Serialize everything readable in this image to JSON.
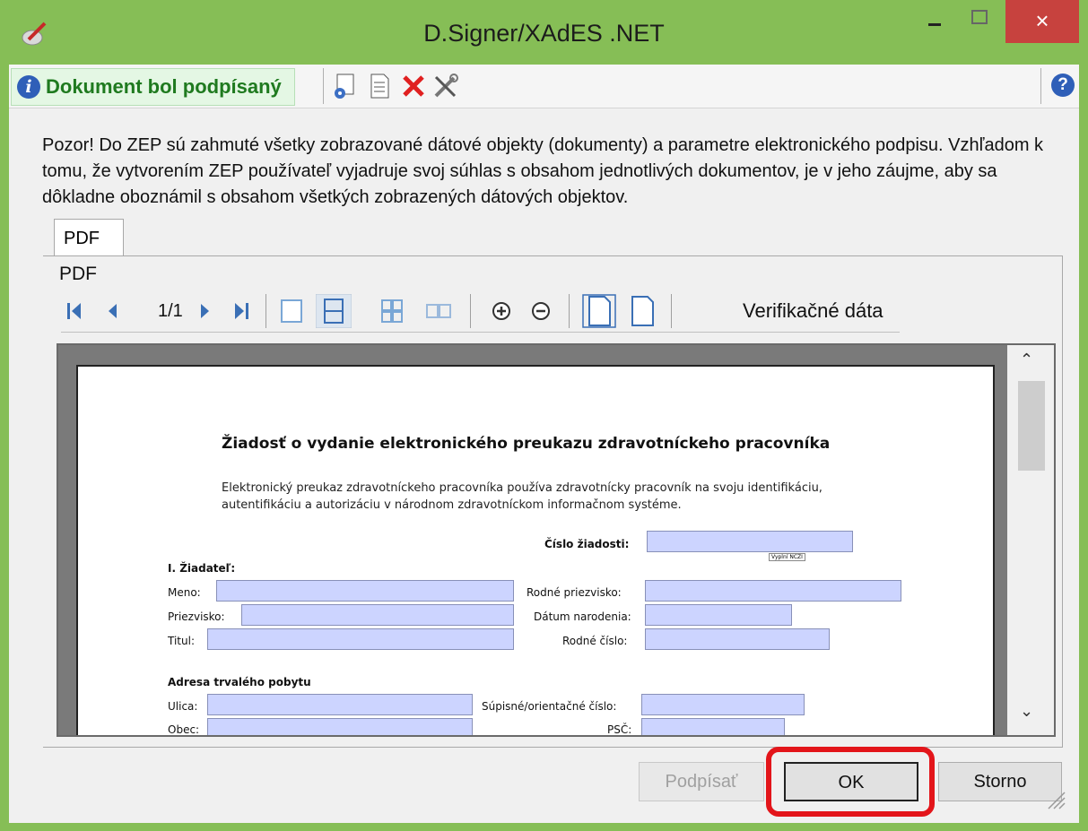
{
  "window": {
    "title": "D.Signer/XAdES .NET",
    "close_glyph": "×"
  },
  "toolbar": {
    "status_text": "Dokument bol podpísaný",
    "icons": [
      "sign-settings-icon",
      "document-icon",
      "delete-icon",
      "tools-icon",
      "help-icon"
    ]
  },
  "warning_text": "Pozor! Do ZEP sú zahmuté všetky zobrazované dátové objekty (dokumenty) a parametre elektronického podpisu. Vzhľadom k tomu, že vytvorením ZEP používateľ vyjadruje svoj súhlas s obsahom jednotlivých dokumentov, je v jeho záujme, aby sa dôkladne oboznámil s obsahom všetkých zobrazených dátových objektov.",
  "tabs": [
    {
      "label": "PDF"
    }
  ],
  "viewer": {
    "panel_label": "PDF",
    "page_indicator": "1/1",
    "verification_label": "Verifikačné dáta"
  },
  "document": {
    "title": "Žiadosť o vydanie elektronického preukazu zdravotníckeho pracovníka",
    "intro": "Elektronický preukaz zdravotníckeho pracovníka používa zdravotnícky pracovník na svoju identifikáciu, autentifikáciu a autorizáciu v národnom zdravotníckom informačnom systéme.",
    "request_number_label": "Číslo žiadosti:",
    "fill_hint": "Vyplní NCZI",
    "section1": "I. Žiadateľ:",
    "labels": {
      "meno": "Meno:",
      "priezvisko": "Priezvisko:",
      "titul": "Titul:",
      "rodne_priezvisko": "Rodné priezvisko:",
      "datum_narodenia": "Dátum narodenia:",
      "rodne_cislo": "Rodné číslo:",
      "adresa": "Adresa trvalého pobytu",
      "ulica": "Ulica:",
      "supisne": "Súpisné/orientačné číslo:",
      "obec": "Obec:",
      "psc": "PSČ:"
    }
  },
  "buttons": {
    "sign": "Podpísať",
    "ok": "OK",
    "cancel": "Storno"
  },
  "colors": {
    "titlebar": "#86be56",
    "close": "#c7423e",
    "highlight": "#e3151a",
    "field": "#ccd4ff"
  }
}
